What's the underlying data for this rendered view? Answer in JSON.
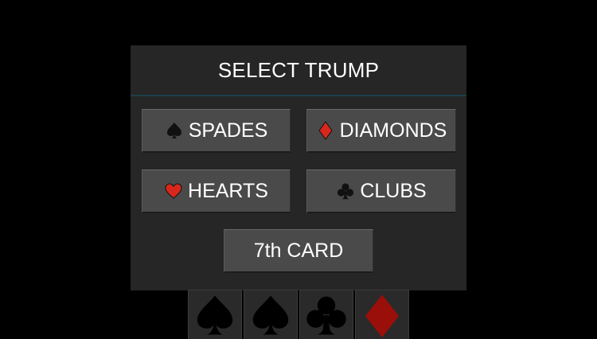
{
  "dialog": {
    "title": "SELECT TRUMP",
    "buttons": {
      "spades": {
        "label": "SPADES",
        "icon": "spade-icon",
        "color": "#111111"
      },
      "diamonds": {
        "label": "DIAMONDS",
        "icon": "diamond-icon",
        "color": "#d8271c"
      },
      "hearts": {
        "label": "HEARTS",
        "icon": "heart-icon",
        "color": "#d8271c"
      },
      "clubs": {
        "label": "CLUBS",
        "icon": "club-icon",
        "color": "#111111"
      },
      "seventh_card": {
        "label": "7th CARD"
      }
    }
  },
  "hand": {
    "cards": [
      {
        "suit": "spade",
        "color": "#000000"
      },
      {
        "suit": "spade",
        "color": "#000000"
      },
      {
        "suit": "club",
        "color": "#000000"
      },
      {
        "suit": "diamond",
        "color": "#9a0f0a"
      }
    ]
  },
  "colors": {
    "background": "#000000",
    "dialog": "#262626",
    "button": "#4a4a4a",
    "header_divider": "#1f3f4a"
  }
}
